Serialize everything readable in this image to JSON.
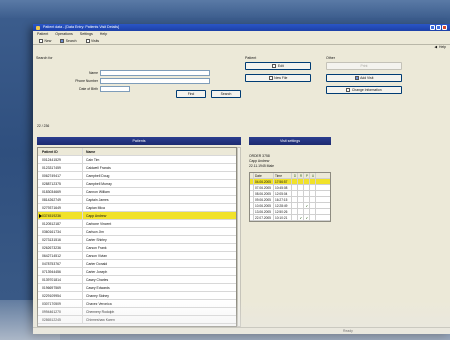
{
  "window": {
    "title": "Patient data - [Data Entry: Patients Visit Details]"
  },
  "menu": [
    "Patient",
    "Operations",
    "Settings",
    "Help"
  ],
  "toolbar": {
    "new": "New",
    "search": "Search",
    "visits": "Visits",
    "right_label": "Help"
  },
  "search": {
    "title": "Search for",
    "name_label": "Name",
    "phone_label": "Phone Number",
    "date_label": "Date of Birth",
    "find_button": "Find",
    "search_button": "Search",
    "count": "22 / 236"
  },
  "patient": {
    "title": "Patient",
    "edit": "Edit",
    "new_file": "New File"
  },
  "other": {
    "title": "Other",
    "disabled": "Print",
    "add_visit": "Add Visit",
    "export": "Change Information"
  },
  "patients": {
    "header": "Patients",
    "col_id": "Patient ID",
    "col_name": "Name",
    "rows": [
      {
        "id": "0012441529",
        "name": "Cain Tim"
      },
      {
        "id": "0123317459",
        "name": "Caldwell Francis"
      },
      {
        "id": "0062749417",
        "name": "Campbell Doug"
      },
      {
        "id": "0288712375",
        "name": "Campbell Murray"
      },
      {
        "id": "0183034669",
        "name": "Cannon William"
      },
      {
        "id": "0814262749",
        "name": "Captain James"
      },
      {
        "id": "0279371649",
        "name": "Capian Mica"
      },
      {
        "id": "0374519236",
        "name": "Capp Andrew"
      },
      {
        "id": "0120512187",
        "name": "Carbone Vincent"
      },
      {
        "id": "0360161734",
        "name": "Carlson Jim"
      },
      {
        "id": "0273131516",
        "name": "Carter Shirley"
      },
      {
        "id": "0262673236",
        "name": "Carson Frank"
      },
      {
        "id": "0642714512",
        "name": "Carson Vivian"
      },
      {
        "id": "0478753767",
        "name": "Carter Donald"
      },
      {
        "id": "0713944456",
        "name": "Carter Joseph"
      },
      {
        "id": "0139701814",
        "name": "Casey Charles"
      },
      {
        "id": "0196697569",
        "name": "Casey Edwards"
      },
      {
        "id": "0229109954",
        "name": "Chaney Sidney"
      },
      {
        "id": "0307170509",
        "name": "Chavez Veronica"
      },
      {
        "id": "0994461270",
        "name": "Chennery Rodolph"
      },
      {
        "id": "0286512245",
        "name": "Chirmeshaw Karen"
      }
    ],
    "selected_index": 7
  },
  "visits": {
    "header": "Visit settings",
    "info": [
      "ORDER 3758",
      "Capp Andrew",
      "22.11.1945      Male"
    ],
    "col_date": "Date",
    "col_time": "Time",
    "flags": [
      "D",
      "R",
      "P",
      "U"
    ],
    "rows": [
      {
        "date": "04.06.2005",
        "time": "17:56:57",
        "marks": [
          "",
          "",
          "",
          ""
        ]
      },
      {
        "date": "07.06.2005",
        "time": "10:45:08",
        "marks": [
          "",
          "",
          "",
          ""
        ]
      },
      {
        "date": "08.06.2005",
        "time": "12:05:04",
        "marks": [
          "",
          "",
          "",
          ""
        ]
      },
      {
        "date": "09.06.2005",
        "time": "16:27:15",
        "marks": [
          "",
          "",
          "",
          ""
        ]
      },
      {
        "date": "10.06.2005",
        "time": "12:28:49",
        "marks": [
          "",
          "",
          "✔",
          ""
        ]
      },
      {
        "date": "13.06.2005",
        "time": "12:50:26",
        "marks": [
          "",
          "",
          "",
          ""
        ]
      },
      {
        "date": "22.07.2005",
        "time": "10:10:21",
        "marks": [
          "",
          "✔",
          "✔",
          ""
        ]
      }
    ],
    "selected_index": 0
  },
  "status": {
    "text": "Ready"
  }
}
